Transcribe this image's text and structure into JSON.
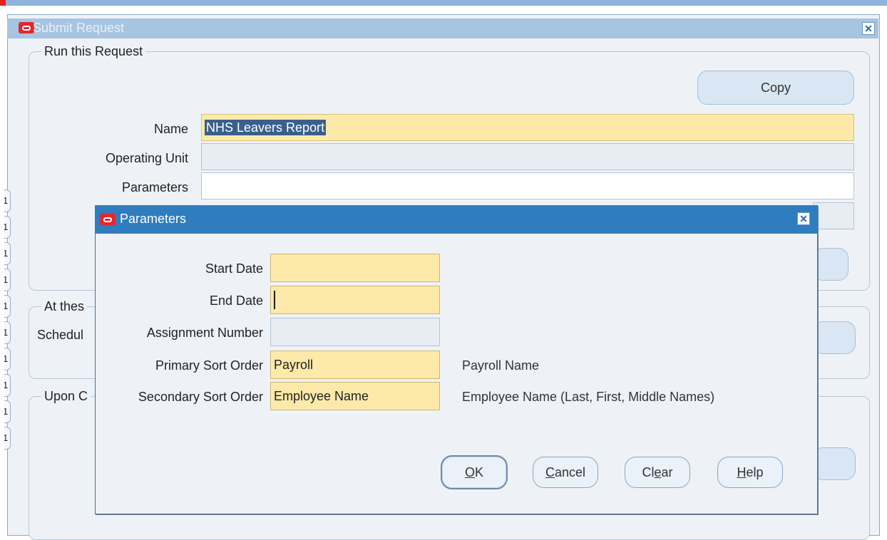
{
  "window": {
    "title": "Submit Request"
  },
  "run_group": {
    "label": "Run this Request",
    "copy_button": "Copy",
    "name_label": "Name",
    "name_value": "NHS Leavers Report",
    "operating_unit_label": "Operating Unit",
    "operating_unit_value": "",
    "parameters_label": "Parameters",
    "parameters_value": ""
  },
  "schedule_group": {
    "label_fragment": "At thes",
    "schedule_fragment": "Schedul"
  },
  "completion_group": {
    "label_fragment": "Upon C"
  },
  "left_edge_tabs": [
    "1",
    "1",
    "1",
    "1",
    "1",
    "1",
    "1",
    "1",
    "1",
    "1"
  ],
  "parameters_dialog": {
    "title": "Parameters",
    "fields": [
      {
        "label": "Start Date",
        "value": "",
        "description": ""
      },
      {
        "label": "End Date",
        "value": "",
        "description": ""
      },
      {
        "label": "Assignment Number",
        "value": "",
        "description": ""
      },
      {
        "label": "Primary Sort Order",
        "value": "Payroll",
        "description": "Payroll Name"
      },
      {
        "label": "Secondary Sort Order",
        "value": "Employee Name",
        "description": "Employee Name (Last, First, Middle Names)"
      }
    ],
    "buttons": {
      "ok_first": "O",
      "ok_rest": "K",
      "cancel_first": "C",
      "cancel_rest": "ancel",
      "clear_pre": "Cl",
      "clear_mnemonic": "e",
      "clear_post": "ar",
      "help_first": "H",
      "help_rest": "elp"
    }
  },
  "colors": {
    "required_field": "#fde9a9",
    "dialog_title_bar": "#2f7dbf",
    "window_title_bar": "#a7c4e1",
    "oracle_logo": "#e4282d"
  }
}
